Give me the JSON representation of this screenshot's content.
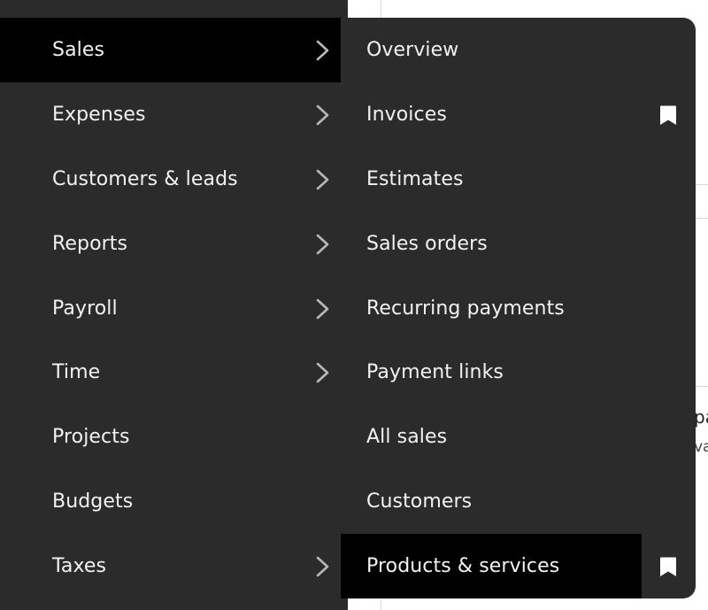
{
  "nav": {
    "items": [
      {
        "label": "Sales",
        "has_submenu": true,
        "active": true
      },
      {
        "label": "Expenses",
        "has_submenu": true,
        "active": false
      },
      {
        "label": "Customers & leads",
        "has_submenu": true,
        "active": false
      },
      {
        "label": "Reports",
        "has_submenu": true,
        "active": false
      },
      {
        "label": "Payroll",
        "has_submenu": true,
        "active": false
      },
      {
        "label": "Time",
        "has_submenu": true,
        "active": false
      },
      {
        "label": "Projects",
        "has_submenu": false,
        "active": false
      },
      {
        "label": "Budgets",
        "has_submenu": false,
        "active": false
      },
      {
        "label": "Taxes",
        "has_submenu": true,
        "active": false
      }
    ]
  },
  "submenu": {
    "items": [
      {
        "label": "Overview",
        "bookmarked": false,
        "highlighted": false
      },
      {
        "label": "Invoices",
        "bookmarked": true,
        "highlighted": false
      },
      {
        "label": "Estimates",
        "bookmarked": false,
        "highlighted": false
      },
      {
        "label": "Sales orders",
        "bookmarked": false,
        "highlighted": false
      },
      {
        "label": "Recurring payments",
        "bookmarked": false,
        "highlighted": false
      },
      {
        "label": "Payment links",
        "bookmarked": false,
        "highlighted": false
      },
      {
        "label": "All sales",
        "bookmarked": false,
        "highlighted": false
      },
      {
        "label": "Customers",
        "bookmarked": false,
        "highlighted": false
      },
      {
        "label": "Products & services",
        "bookmarked": true,
        "highlighted": true
      }
    ]
  },
  "background": {
    "partial_text_1": "pa",
    "partial_text_2": "va"
  },
  "colors": {
    "panel": "#2b2b2c",
    "active": "#000000",
    "text": "#f2f2f2",
    "chevron": "#b8b8b8",
    "bookmark": "#ffffff"
  },
  "icons": {
    "chevron": "chevron-right-icon",
    "bookmark": "bookmark-icon"
  }
}
